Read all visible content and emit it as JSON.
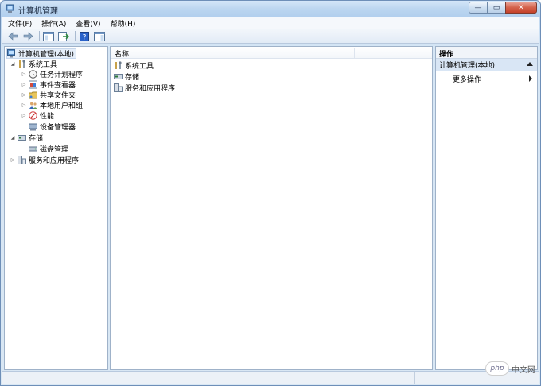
{
  "window": {
    "title": "计算机管理",
    "minimize_glyph": "—",
    "restore_glyph": "▭",
    "close_glyph": "✕"
  },
  "menubar": {
    "items": [
      "文件(F)",
      "操作(A)",
      "查看(V)",
      "帮助(H)"
    ]
  },
  "toolbar": {
    "icons": [
      "back-arrow-icon",
      "forward-arrow-icon",
      "show-hide-tree-icon",
      "export-list-icon",
      "help-icon",
      "show-action-pane-icon"
    ]
  },
  "tree": {
    "root": "计算机管理(本地)",
    "system_tools": "系统工具",
    "task_scheduler": "任务计划程序",
    "event_viewer": "事件查看器",
    "shared_folders": "共享文件夹",
    "local_users_groups": "本地用户和组",
    "performance": "性能",
    "device_manager": "设备管理器",
    "storage": "存储",
    "disk_management": "磁盘管理",
    "services_apps": "服务和应用程序"
  },
  "list": {
    "column_name": "名称",
    "rows": [
      "系统工具",
      "存储",
      "服务和应用程序"
    ]
  },
  "actions": {
    "header": "操作",
    "group": "计算机管理(本地)",
    "more_actions": "更多操作"
  },
  "watermark": {
    "logo": "php",
    "text": "中文网"
  },
  "colors": {
    "title_bar": "#bcd6f0",
    "tree_selection": "#e5eef9",
    "action_group": "#d9e6f5",
    "close_button": "#d4624b"
  }
}
